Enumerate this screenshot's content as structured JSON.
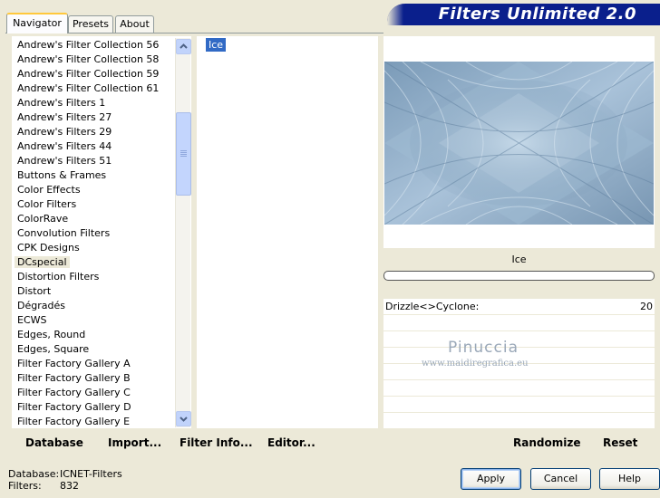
{
  "tabs": [
    {
      "label": "Navigator"
    },
    {
      "label": "Presets"
    },
    {
      "label": "About"
    }
  ],
  "banner": {
    "title": "Filters Unlimited 2.0"
  },
  "categories": [
    "Andrew's Filter Collection 56",
    "Andrew's Filter Collection 58",
    "Andrew's Filter Collection 59",
    "Andrew's Filter Collection 61",
    "Andrew's Filters 1",
    "Andrew's Filters 27",
    "Andrew's Filters 29",
    "Andrew's Filters 44",
    "Andrew's Filters 51",
    "Buttons & Frames",
    "Color Effects",
    "Color Filters",
    "ColorRave",
    "Convolution Filters",
    "CPK Designs",
    "DCspecial",
    "Distortion Filters",
    "Distort",
    "Dégradés",
    "ECWS",
    "Edges, Round",
    "Edges, Square",
    "Filter Factory Gallery A",
    "Filter Factory Gallery B",
    "Filter Factory Gallery C",
    "Filter Factory Gallery D",
    "Filter Factory Gallery E"
  ],
  "selected_category": "DCspecial",
  "filters": {
    "selected": "Ice"
  },
  "preview": {
    "filter_name": "Ice"
  },
  "params": [
    {
      "label": "Drizzle<>Cyclone:",
      "value": "20"
    }
  ],
  "watermark": {
    "name": "Pinuccia",
    "url": "www.maidiregrafica.eu"
  },
  "toolbar": {
    "database": "Database",
    "import": "Import...",
    "filter_info": "Filter Info...",
    "editor": "Editor...",
    "randomize": "Randomize",
    "reset": "Reset"
  },
  "status": {
    "database_label": "Database:",
    "database_value": "ICNET-Filters",
    "filters_label": "Filters:",
    "filters_value": "832"
  },
  "buttons": {
    "apply": "Apply",
    "cancel": "Cancel",
    "help": "Help"
  },
  "colors": {
    "banner": "#0a1f8c",
    "selection": "#316ac5",
    "window": "#ece9d8"
  }
}
